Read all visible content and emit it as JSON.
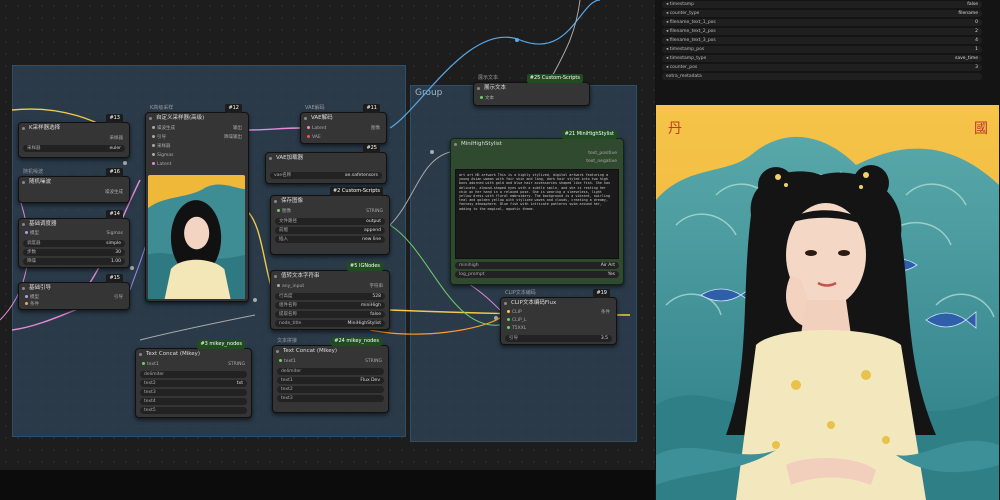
{
  "panel_rows": [
    {
      "label": "timestamp",
      "value": "false"
    },
    {
      "label": "counter_type",
      "value": "filename"
    },
    {
      "label": "filename_text_1_pos",
      "value": "0"
    },
    {
      "label": "filename_text_2_pos",
      "value": "2"
    },
    {
      "label": "filename_text_3_pos",
      "value": "4"
    },
    {
      "label": "timestamp_pos",
      "value": "1"
    },
    {
      "label": "timestamp_type",
      "value": "save_time"
    },
    {
      "label": "counter_pos",
      "value": "3"
    },
    {
      "label": "extra_metadata",
      "value": ""
    }
  ],
  "group_label": "Group",
  "nodes": {
    "ksampler": {
      "badge": "#13",
      "label": "K采样器选择",
      "field": {
        "k": "采样器",
        "v": "euler"
      },
      "out": "采样器"
    },
    "advanced": {
      "title": "K高级采样",
      "badge": "#12",
      "label": "自定义采样器(高级)",
      "inputs": [
        "噪波生成",
        "引导",
        "采样器",
        "Sigmas",
        "Latent"
      ],
      "outputs": [
        "输出",
        "降噪输出"
      ]
    },
    "noise": {
      "title": "随机噪波",
      "badge": "#16",
      "label": "随机噪波",
      "out": "噪波生成"
    },
    "scheduler": {
      "badge": "#14",
      "label": "基础调度器",
      "in": "模型",
      "out": "Sigmas",
      "fields": [
        {
          "k": "调度器",
          "v": "simple"
        },
        {
          "k": "步数",
          "v": "30"
        },
        {
          "k": "降噪",
          "v": "1.00"
        }
      ]
    },
    "guider": {
      "badge": "#15",
      "label": "基础引导",
      "inputs": [
        "模型",
        "条件"
      ],
      "out": "引导"
    },
    "vae_decode": {
      "title": "VAE解码",
      "badge": "#11",
      "label": "VAE解码",
      "inputs": [
        "Latent",
        "VAE"
      ],
      "out": "图像"
    },
    "vae_loader": {
      "badge": "#25",
      "label": "VAE加载器",
      "field": {
        "k": "vae名称",
        "v": "ae.safetensors"
      }
    },
    "save_image": {
      "badge": "#2 Custom-Scripts",
      "label": "保存图像",
      "in": "图像",
      "out": "STRING",
      "fields": [
        {
          "k": "文件路径",
          "v": "output"
        },
        {
          "k": "前缀",
          "v": "append"
        },
        {
          "k": "插入",
          "v": "new line"
        }
      ]
    },
    "loader": {
      "badge": "#5 IGNodes",
      "label": "值转文本字符串",
      "in": "any_input",
      "out": "字符串",
      "fields": [
        {
          "k": "行高度",
          "v": "528"
        },
        {
          "k": "组件名称",
          "v": "miniHigh"
        },
        {
          "k": "提取名称",
          "v": "false"
        },
        {
          "k": "node_title",
          "v": "MiniHighStylist"
        }
      ]
    },
    "show_text": {
      "title": "展示文本",
      "badge": "#25 Custom-Scripts",
      "label": "展示文本",
      "in": "文本"
    },
    "prompt": {
      "badge": "#21 MiniHighStylist",
      "label": "MiniHighStylist",
      "outputs": [
        "text_positive",
        "text_negative"
      ],
      "text": "art art HD artwork This is a highly stylized, digital artwork featuring a young Asian woman with fair skin and long, dark hair styled into two high buns adorned with gold and blue hair accessories shaped like fish. She has delicate, almond-shaped eyes with a subtle smile, and she is resting her chin on her hand in a relaxed pose. She is wearing a sleeveless, light yellow dress with floral embroidery. The background is a vibrant, swirling teal and golden yellow with stylized waves and clouds, creating a dreamy, fantasy atmosphere. Blue fish with intricate patterns swim around her, adding to the magical, aquatic theme.",
      "fields": [
        {
          "k": "minihigh",
          "v": "Air Art"
        },
        {
          "k": "log_prompt",
          "v": "Yes"
        }
      ]
    },
    "clip": {
      "title": "CLIP文本编码",
      "badge": "#19",
      "label": "CLIP文本编码Flux",
      "inputs": [
        "CLIP",
        "CLIP_L",
        "T5XXL"
      ],
      "out": "条件",
      "field": {
        "k": "引导",
        "v": "3.5"
      }
    },
    "concat1": {
      "badge": "#3 mikey_nodes",
      "label": "Text Concat (Mikey)",
      "in": "text1",
      "out": "STRING",
      "fields": [
        {
          "k": "delimiter",
          "v": ""
        },
        {
          "k": "text2",
          "v": "txt"
        },
        {
          "k": "text3",
          "v": ""
        },
        {
          "k": "text4",
          "v": ""
        },
        {
          "k": "text5",
          "v": ""
        }
      ]
    },
    "concat2": {
      "title": "文本拼接",
      "badge": "#24 mikey_nodes",
      "label": "Text Concat (Mikey)",
      "in": "text1",
      "out": "STRING",
      "fields": [
        {
          "k": "delimiter",
          "v": ""
        },
        {
          "k": "text1",
          "v": "Flux Dev"
        },
        {
          "k": "text2",
          "v": ""
        },
        {
          "k": "text3",
          "v": ""
        }
      ]
    }
  },
  "colors": {
    "group": "#34526e",
    "accent": "#4aa3ff",
    "wire_yellow": "#f2c94c",
    "wire_pink": "#e58ad6",
    "wire_blue": "#5aa9e6",
    "wire_orange": "#ff9b2e"
  }
}
